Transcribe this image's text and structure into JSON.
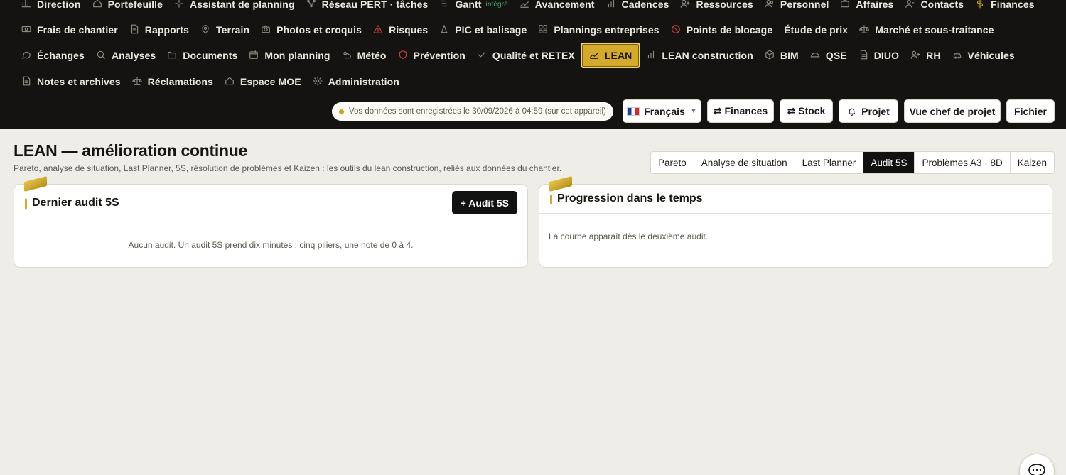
{
  "nav": {
    "row1": [
      {
        "label": "Direction",
        "icon": "chart-icon"
      },
      {
        "label": "Portefeuille",
        "icon": "home-icon"
      },
      {
        "label": "Assistant de planning",
        "icon": "sparkle-icon"
      },
      {
        "label": "Réseau PERT · tâches",
        "icon": "network-icon"
      },
      {
        "label": "Gantt",
        "icon": "gantt-icon",
        "tag": "intégré"
      },
      {
        "label": "Avancement",
        "icon": "trend-icon"
      },
      {
        "label": "Cadences",
        "icon": "bars-icon"
      },
      {
        "label": "Ressources",
        "icon": "user-plus-icon"
      },
      {
        "label": "Personnel",
        "icon": "users-icon"
      },
      {
        "label": "Affaires",
        "icon": "briefcase-icon"
      },
      {
        "label": "Contacts",
        "icon": "contact-icon"
      },
      {
        "label": "Finances",
        "icon": "dollar-icon"
      }
    ],
    "row2": [
      {
        "label": "Frais de chantier",
        "icon": "banknote-icon"
      },
      {
        "label": "Rapports",
        "icon": "file-icon"
      },
      {
        "label": "Terrain",
        "icon": "pin-icon"
      },
      {
        "label": "Photos et croquis",
        "icon": "camera-icon"
      },
      {
        "label": "Risques",
        "icon": "warning-icon"
      },
      {
        "label": "PIC et balisage",
        "icon": "cone-icon"
      },
      {
        "label": "Plannings entreprises",
        "icon": "grid-icon"
      },
      {
        "label": "Points de blocage",
        "icon": "block-icon"
      },
      {
        "label": "Étude de prix",
        "icon": ""
      },
      {
        "label": "Marché et sous-traitance",
        "icon": "scale-icon"
      }
    ],
    "row3": [
      {
        "label": "Échanges",
        "icon": "chat-icon"
      },
      {
        "label": "Analyses",
        "icon": "search-icon"
      },
      {
        "label": "Documents",
        "icon": "folder-icon"
      },
      {
        "label": "Mon planning",
        "icon": "calendar-icon"
      },
      {
        "label": "Météo",
        "icon": "weather-icon"
      },
      {
        "label": "Prévention",
        "icon": "shield-icon"
      },
      {
        "label": "Qualité et RETEX",
        "icon": "check-icon"
      },
      {
        "label": "LEAN",
        "icon": "trend-icon",
        "active": true
      },
      {
        "label": "LEAN construction",
        "icon": "bars-icon"
      },
      {
        "label": "BIM",
        "icon": "cube-icon"
      },
      {
        "label": "QSE",
        "icon": "helmet-icon"
      },
      {
        "label": "DIUO",
        "icon": "file-icon"
      },
      {
        "label": "RH",
        "icon": "user-plus-icon"
      },
      {
        "label": "Véhicules",
        "icon": "car-icon"
      }
    ],
    "row4": [
      {
        "label": "Notes et archives",
        "icon": "file-icon"
      },
      {
        "label": "Réclamations",
        "icon": "scale-icon"
      },
      {
        "label": "Espace MOE",
        "icon": "home-icon"
      },
      {
        "label": "Administration",
        "icon": "gear-icon"
      }
    ]
  },
  "header": {
    "save_status": "Vos données sont enregistrées le 30/09/2026 à 04:59 (sur cet appareil)",
    "language": "Français",
    "finances_btn": "⇄ Finances",
    "stock_btn": "⇄ Stock",
    "projet_btn": "Projet",
    "chef_btn": "Vue chef de projet",
    "fichier_btn": "Fichier"
  },
  "page": {
    "title": "LEAN — amélioration continue",
    "subtitle": "Pareto, analyse de situation, Last Planner, 5S, résolution de problèmes et Kaizen : les outils du lean construction, reliés aux données du chantier."
  },
  "tabs": [
    {
      "label": "Pareto"
    },
    {
      "label": "Analyse de situation"
    },
    {
      "label": "Last Planner"
    },
    {
      "label": "Audit 5S",
      "active": true
    },
    {
      "label": "Problèmes A3 · 8D"
    },
    {
      "label": "Kaizen"
    }
  ],
  "cards": {
    "audit": {
      "title": "Dernier audit 5S",
      "add_btn": "+ Audit 5S",
      "empty": "Aucun audit. Un audit 5S prend dix minutes : cinq piliers, une note de 0 à 4."
    },
    "progress": {
      "title": "Progression dans le temps",
      "empty": "La courbe apparaît dès le deuxième audit."
    }
  },
  "colors": {
    "accent": "#d4aa2c",
    "header_bg": "#141311",
    "page_bg": "#efede8"
  }
}
